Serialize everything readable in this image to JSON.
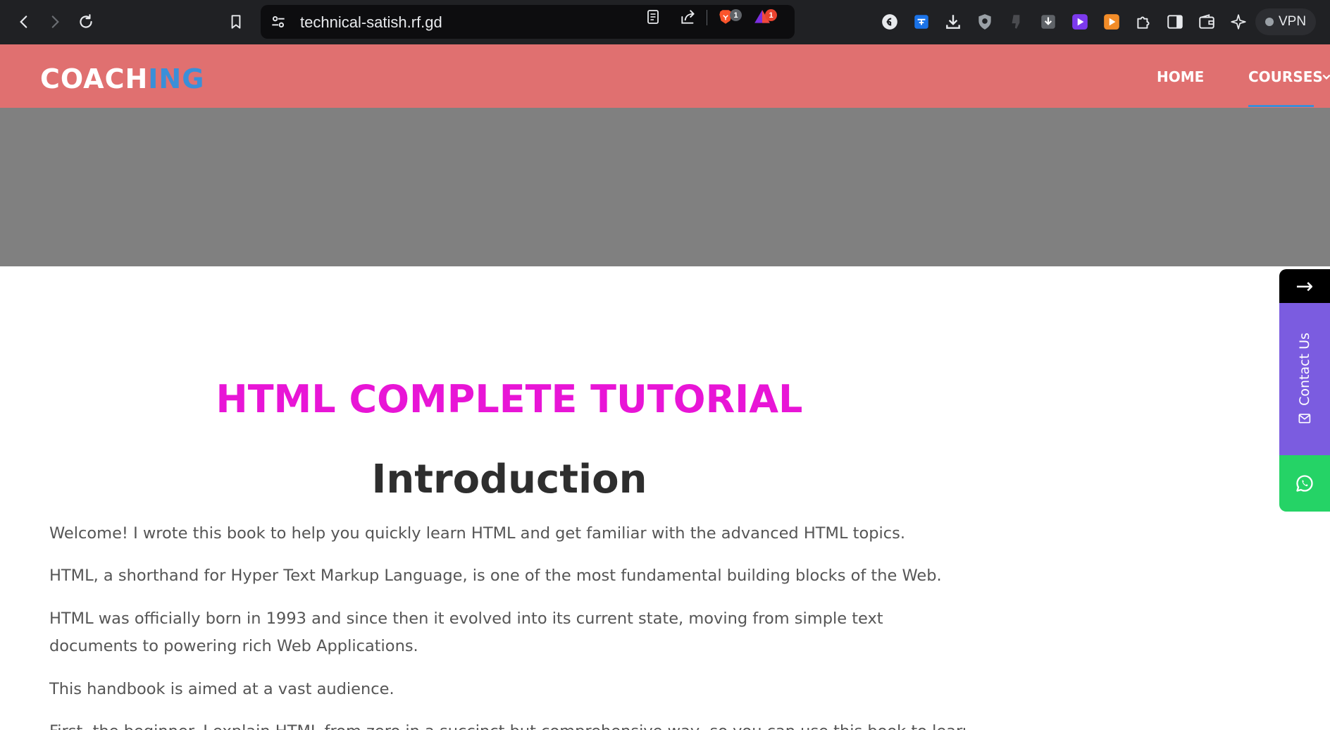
{
  "browser": {
    "url": "technical-satish.rf.gd",
    "brave_badge": "1",
    "rewards_badge": "1",
    "vpn_label": "VPN"
  },
  "site": {
    "logo_part1": "COACH",
    "logo_part2": "ING",
    "nav": [
      {
        "label": "HOME"
      },
      {
        "label": "COURSES"
      }
    ]
  },
  "article": {
    "title": "HTML COMPLETE TUTORIAL",
    "heading": "Introduction",
    "paragraphs": [
      "Welcome! I wrote this book to help you quickly learn HTML and get familiar with the advanced HTML topics.",
      "HTML, a shorthand for Hyper Text Markup Language, is one of the most fundamental building blocks of the Web.",
      "HTML was officially born in 1993 and since then it evolved into its current state, moving from simple text documents to powering rich Web Applications.",
      "This handbook is aimed at a vast audience.",
      "First, the beginner. I explain HTML from zero in a succinct but comprehensive way, so you can use this book to learn HTML"
    ]
  },
  "widget": {
    "arrow": "→",
    "contact_label": "Contact Us"
  },
  "colors": {
    "header_bg": "#e07070",
    "logo_accent": "#3a8fd8",
    "title": "#e815d6",
    "hero_bg": "#808080",
    "contact_bg": "#7b5ce0",
    "whatsapp_bg": "#25d366"
  }
}
